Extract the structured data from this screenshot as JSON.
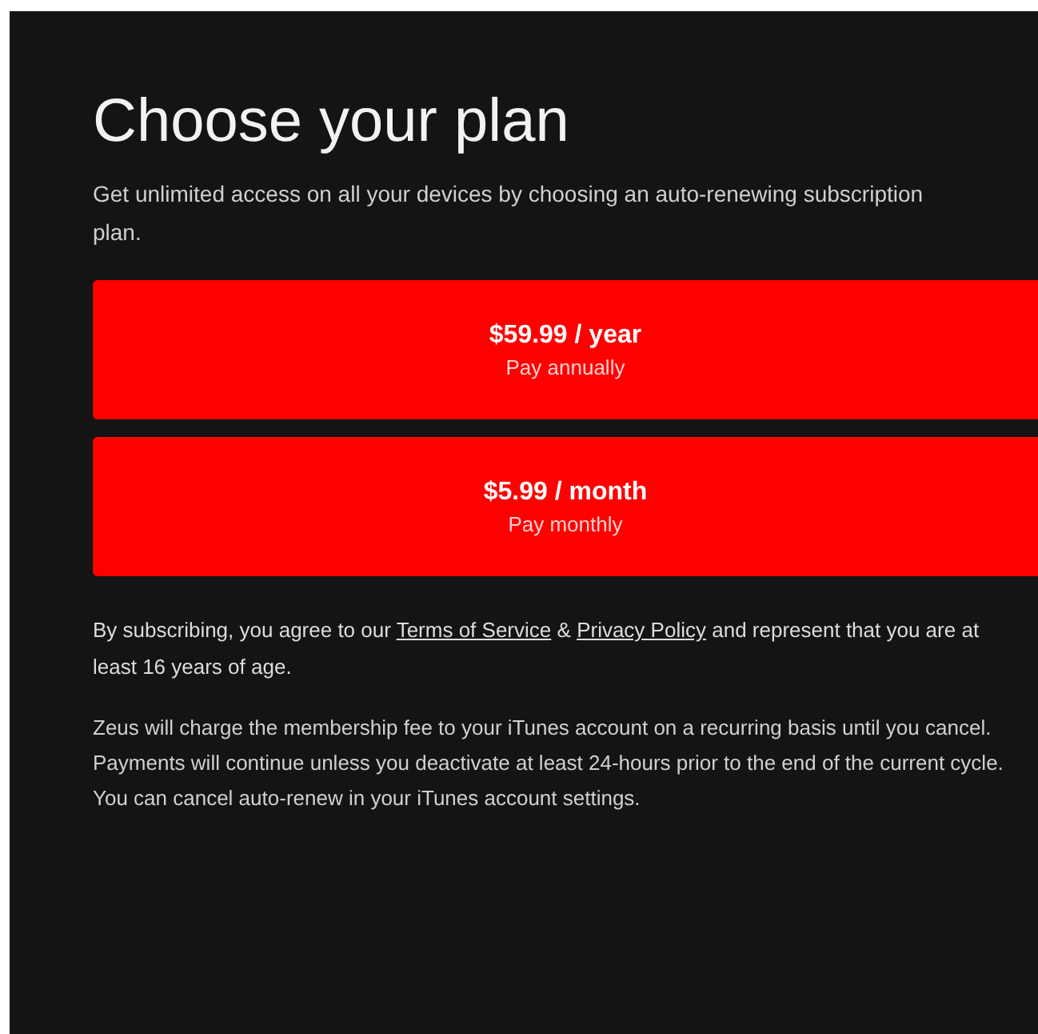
{
  "title": "Choose your plan",
  "subtitle": "Get unlimited access on all your devices by choosing an auto-renewing subscription plan.",
  "plans": [
    {
      "price": "$59.99 / year",
      "caption": "Pay annually"
    },
    {
      "price": "$5.99 / month",
      "caption": "Pay monthly"
    }
  ],
  "terms": {
    "before": "By subscribing, you agree to our",
    "terms_link": "Terms of Service",
    "between": "&",
    "privacy_link": "Privacy Policy",
    "after": "and represent that you are at least 16 years of age."
  },
  "billing_note": "Zeus will charge the membership fee to your iTunes account on a recurring basis until you cancel. Payments will continue unless you deactivate at least 24-hours prior to the end of the current cycle. You can cancel auto-renew in your iTunes account settings."
}
